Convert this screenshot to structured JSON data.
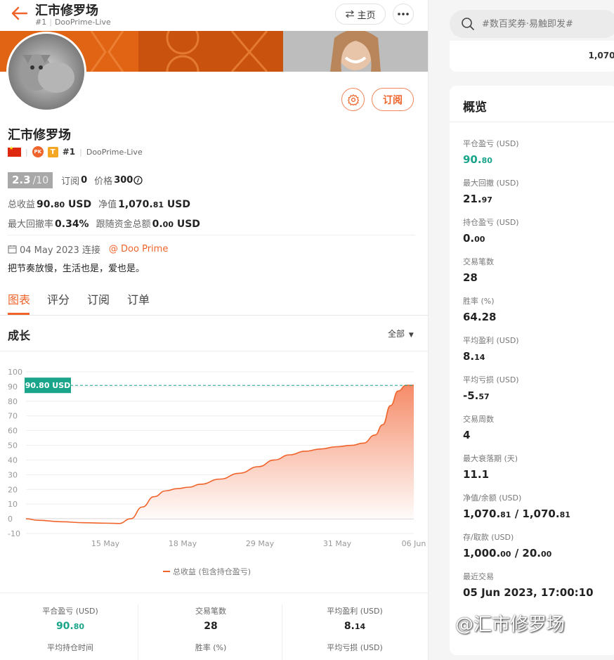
{
  "header": {
    "title": "汇市修罗场",
    "rank": "#1",
    "server": "DooPrime-Live",
    "home_label": "主页"
  },
  "profile": {
    "name": "汇市修罗场",
    "rank": "#1",
    "server": "DooPrime-Live",
    "pk_badge": "PK",
    "t_badge": "T",
    "subscribe_label": "订阅",
    "score": "2.3",
    "score_den": "/10",
    "subs_label": "订阅",
    "subs_value": "0",
    "price_label": "价格",
    "price_value": "300",
    "total_profit_label": "总收益",
    "total_profit_int": "90.",
    "total_profit_dec": "80",
    "total_profit_unit": "USD",
    "equity_label": "净值",
    "equity_int": "1,070.",
    "equity_dec": "81",
    "equity_unit": "USD",
    "drawdown_label": "最大回撤率",
    "drawdown_value": "0.34%",
    "follow_label": "跟随资金总额",
    "follow_int": "0.",
    "follow_dec": "00",
    "follow_unit": "USD",
    "joined": "04 May 2023 连接",
    "broker": "@ Doo Prime",
    "bio": "把节奏放慢，生活也是，爱也是。"
  },
  "tabs": [
    "图表",
    "评分",
    "订阅",
    "订单"
  ],
  "growth": {
    "title": "成长",
    "range_label": "全部",
    "legend": "总收益 (包含持仓盈亏)"
  },
  "chart_data": {
    "type": "area",
    "y_ticks": [
      100,
      90,
      80,
      70,
      60,
      50,
      40,
      30,
      20,
      10,
      0,
      -10
    ],
    "x_ticks": [
      "15 May",
      "18 May",
      "29 May",
      "31 May",
      "06 Jun"
    ],
    "ylim": [
      -10,
      100
    ],
    "current_label": "90.80 USD",
    "current_value": 90.8,
    "series": [
      {
        "points": [
          [
            0,
            0
          ],
          [
            0.03,
            -1
          ],
          [
            0.09,
            -2
          ],
          [
            0.15,
            -2.7
          ],
          [
            0.21,
            -3
          ],
          [
            0.24,
            -3.2
          ],
          [
            0.27,
            0
          ],
          [
            0.3,
            8
          ],
          [
            0.33,
            15
          ],
          [
            0.36,
            19
          ],
          [
            0.39,
            20.5
          ],
          [
            0.42,
            21.5
          ],
          [
            0.45,
            23.5
          ],
          [
            0.5,
            27
          ],
          [
            0.55,
            31
          ],
          [
            0.6,
            35.5
          ],
          [
            0.64,
            40
          ],
          [
            0.68,
            43.5
          ],
          [
            0.72,
            46
          ],
          [
            0.76,
            47.5
          ],
          [
            0.8,
            49
          ],
          [
            0.84,
            50
          ],
          [
            0.87,
            51.5
          ],
          [
            0.9,
            57
          ],
          [
            0.92,
            64
          ],
          [
            0.94,
            77
          ],
          [
            0.96,
            87
          ],
          [
            0.98,
            90.8
          ],
          [
            1.0,
            90.8
          ]
        ]
      }
    ],
    "colors": {
      "line": "#f0642c",
      "fill_top": "#f58560",
      "fill_bottom": "#ffffff",
      "label_bg": "#1aa58a"
    }
  },
  "bottom_stats": [
    {
      "label": "平合盈亏 (USD)",
      "int": "90.",
      "dec": "80",
      "green": true
    },
    {
      "label": "交易笔数",
      "int": "28",
      "dec": "",
      "green": false
    },
    {
      "label": "平均盈利 (USD)",
      "int": "8.",
      "dec": "14",
      "green": false
    },
    {
      "label": "平均持仓时间",
      "int": "",
      "dec": "",
      "green": false
    },
    {
      "label": "胜率 (%)",
      "int": "",
      "dec": "",
      "green": false
    },
    {
      "label": "平均亏损 (USD)",
      "int": "",
      "dec": "",
      "green": false
    }
  ],
  "sidebar": {
    "search_placeholder": "#数百奖券·易触即发#",
    "top_value": "1,070.",
    "overview_title": "概览",
    "items": [
      {
        "label": "平仓盈亏 (USD)",
        "value": "90.",
        "dec": "80",
        "green": true
      },
      {
        "label": "最大回撤 (USD)",
        "value": "21.",
        "dec": "97"
      },
      {
        "label": "持仓盈亏 (USD)",
        "value": "0.",
        "dec": "00"
      },
      {
        "label": "交易笔数",
        "value": "28",
        "dec": ""
      },
      {
        "label": "胜率 (%)",
        "value": "64.28",
        "dec": ""
      },
      {
        "label": "平均盈利 (USD)",
        "value": "8.",
        "dec": "14"
      },
      {
        "label": "平均亏损 (USD)",
        "value": "-5.",
        "dec": "57"
      },
      {
        "label": "交易周数",
        "value": "4",
        "dec": ""
      },
      {
        "label": "最大衰落期 (天)",
        "value": "11.1",
        "dec": ""
      },
      {
        "label": "净值/余额 (USD)",
        "value": "1,070.",
        "dec": "81",
        "value2": "1,070.",
        "dec2": "81"
      },
      {
        "label": "存/取款 (USD)",
        "value": "1,000.",
        "dec": "00",
        "value2": "20.",
        "dec2": "00"
      },
      {
        "label": "最近交易",
        "value": "05 Jun 2023, 17:00:10",
        "dec": ""
      }
    ]
  },
  "watermark": "@汇市修罗场"
}
